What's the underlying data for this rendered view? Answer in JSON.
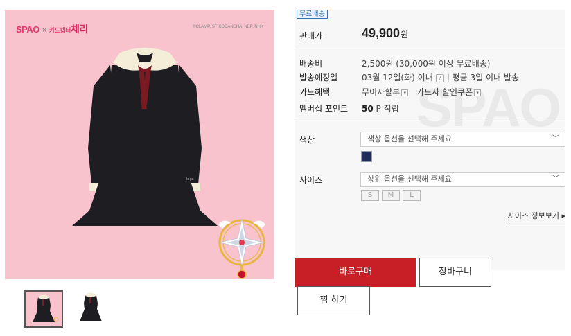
{
  "product_image": {
    "brand_logo": "SPAO",
    "collab_sep": "×",
    "collab_sub": "카드캡터",
    "collab_name": "체리",
    "copyright": "©CLAMP, ST·KODANSHA, NEP, NHK",
    "thumbnails": [
      "thumb-front-pink",
      "thumb-front-white"
    ]
  },
  "info": {
    "free_shipping_badge": "무료배송",
    "price_label": "판매가",
    "price_value": "49,900",
    "price_unit": "원",
    "shipping_label": "배송비",
    "shipping_value": "2,500원 (30,000원 이상 무료배송)",
    "ship_date_label": "발송예정일",
    "ship_date_value": "03월 12일(화) 이내",
    "ship_date_help": "?",
    "ship_date_avg": "|  평균 3일 이내 발송",
    "card_label": "카드혜택",
    "card_installment": "무이자할부",
    "card_coupon": "카드사 할인쿠폰",
    "points_label": "멤버십 포인트",
    "points_value": "50",
    "points_unit": "P 적립",
    "watermark": "SPAO"
  },
  "options": {
    "color_label": "색상",
    "color_placeholder": "색상 옵션을 선택해 주세요.",
    "color_swatch": "#1f2b5b",
    "size_label": "사이즈",
    "size_placeholder": "상위 옵션을 선택해 주세요.",
    "sizes": [
      "S",
      "M",
      "L"
    ],
    "size_guide": "사이즈 정보보기 ▸"
  },
  "actions": {
    "buy_now": "바로구매",
    "cart": "장바구니",
    "wishlist": "찜 하기"
  },
  "colors": {
    "accent_red": "#c81f26",
    "image_bg_pink": "#f8c3cc",
    "badge_blue": "#3a6fb0"
  }
}
